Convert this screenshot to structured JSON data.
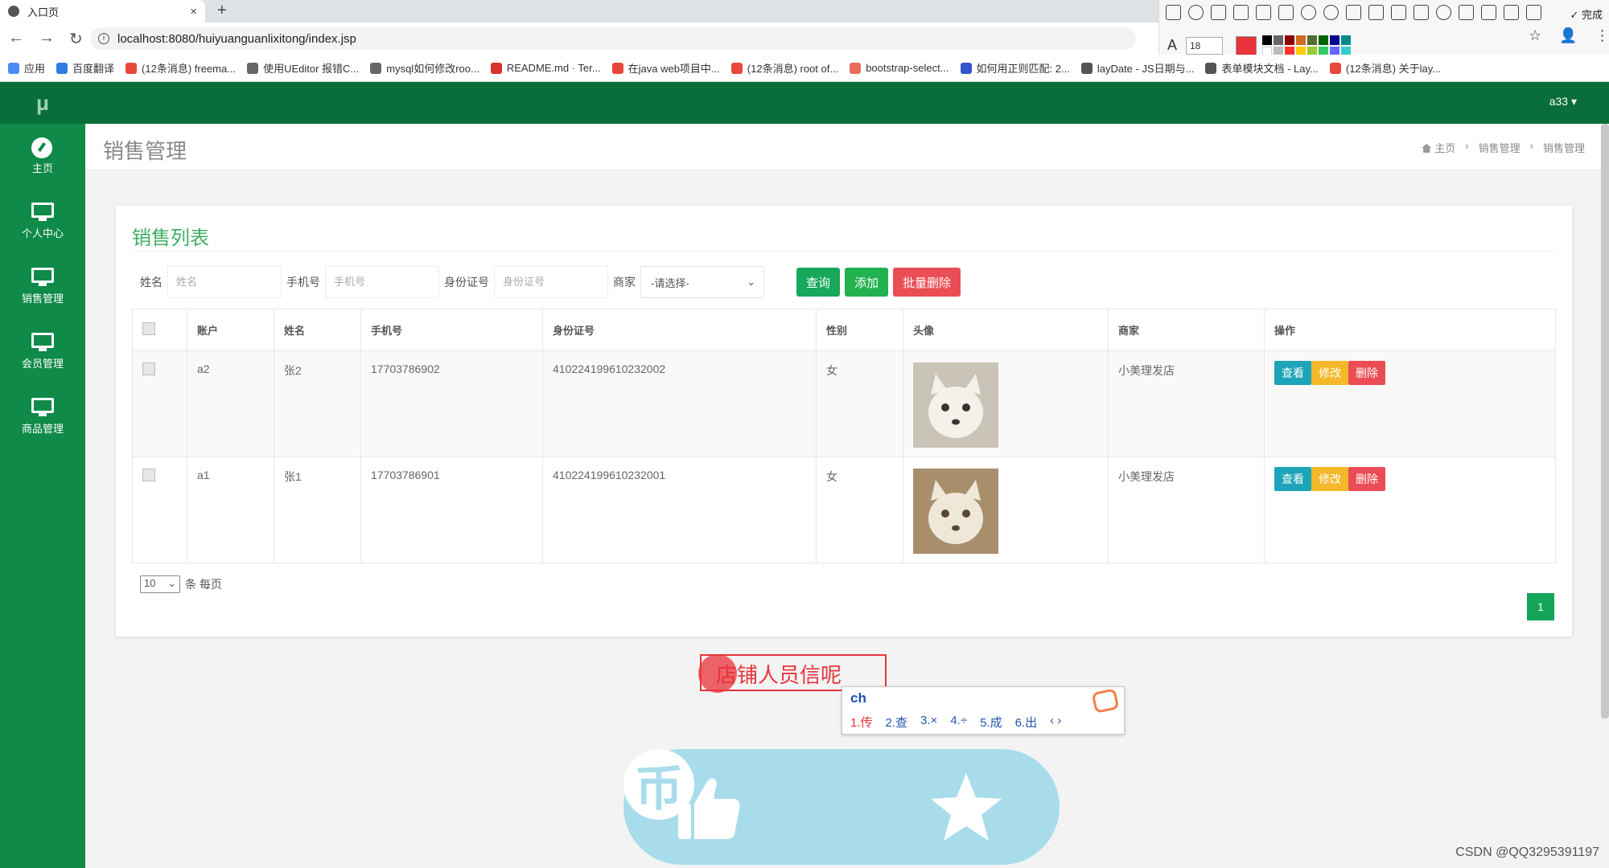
{
  "browser": {
    "tab_title": "入口页",
    "tab_close": "×",
    "new_tab": "+",
    "url": "localhost:8080/huiyuanguanlixitong/index.jsp",
    "back": "←",
    "forward": "→",
    "reload": "↻",
    "bookmark_star": "☆",
    "profile": "👤",
    "menu": "⋮",
    "bookmarks": [
      {
        "label": "应用",
        "color": "#4a8af4"
      },
      {
        "label": "百度翻译",
        "color": "#2f7de1"
      },
      {
        "label": "(12条消息) freema...",
        "color": "#e8483a"
      },
      {
        "label": "使用UEditor 报错C...",
        "color": "#666666"
      },
      {
        "label": "mysql如何修改roo...",
        "color": "#666666"
      },
      {
        "label": "README.md · Ter...",
        "color": "#d8322d"
      },
      {
        "label": "在java web项目中...",
        "color": "#e8483a"
      },
      {
        "label": "(12条消息) root of...",
        "color": "#e8483a"
      },
      {
        "label": "bootstrap-select...",
        "color": "#e86d5c"
      },
      {
        "label": "如何用正则匹配: 2...",
        "color": "#3355cc"
      },
      {
        "label": "layDate - JS日期与...",
        "color": "#555555"
      },
      {
        "label": "表单模块文档 - Lay...",
        "color": "#555555"
      },
      {
        "label": "(12条消息) 关于lay...",
        "color": "#e8483a"
      }
    ],
    "snip_done": "✓ 完成",
    "snip_font_icon": "A",
    "snip_font_size": "18"
  },
  "app": {
    "logo": "μ",
    "user": "a33 ▾",
    "sidebar": [
      {
        "label": "主页",
        "icon": "dashboard-icon"
      },
      {
        "label": "个人中心",
        "icon": "monitor-icon"
      },
      {
        "label": "销售管理",
        "icon": "monitor-icon"
      },
      {
        "label": "会员管理",
        "icon": "monitor-icon"
      },
      {
        "label": "商品管理",
        "icon": "monitor-icon"
      }
    ],
    "page_title": "销售管理",
    "breadcrumb": {
      "home": "主页",
      "sep": "›",
      "level1": "销售管理",
      "level2": "销售管理"
    },
    "list_title": "销售列表",
    "search": {
      "name_label": "姓名",
      "name_placeholder": "姓名",
      "phone_label": "手机号",
      "phone_placeholder": "手机号",
      "id_label": "身份证号",
      "id_placeholder": "身份证号",
      "merchant_label": "商家",
      "merchant_value": "-请选择-",
      "query_btn": "查询",
      "add_btn": "添加",
      "batch_delete_btn": "批量删除"
    },
    "table": {
      "headers": [
        "账户",
        "姓名",
        "手机号",
        "身份证号",
        "性别",
        "头像",
        "商家",
        "操作"
      ],
      "rows": [
        {
          "account": "a2",
          "name": "张2",
          "phone": "17703786902",
          "id_card": "410224199610232002",
          "gender": "女",
          "merchant": "小美理发店"
        },
        {
          "account": "a1",
          "name": "张1",
          "phone": "17703786901",
          "id_card": "410224199610232001",
          "gender": "女",
          "merchant": "小美理发店"
        }
      ],
      "actions": {
        "view": "查看",
        "edit": "修改",
        "delete": "删除"
      }
    },
    "pagination": {
      "page_size": "10",
      "per_page_label": "条 每页",
      "current_page": "1"
    }
  },
  "overlay": {
    "annotation_text": "店铺人员信呢",
    "ime_input": "ch",
    "ime_candidates": [
      "1.传",
      "2.查",
      "3.×",
      "4.÷",
      "5.成",
      "6.出",
      "‹ ›"
    ],
    "coin_glyph": "币"
  },
  "watermark": "CSDN @QQ3295391197"
}
